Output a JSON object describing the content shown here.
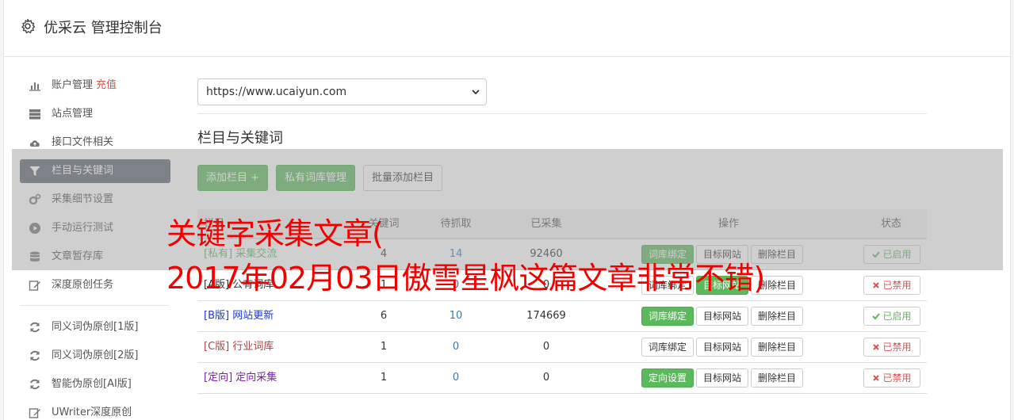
{
  "header": {
    "title": "优采云 管理控制台"
  },
  "sidebar": {
    "items": [
      {
        "label": "账户管理",
        "extra": "充值"
      },
      {
        "label": "站点管理"
      },
      {
        "label": "接口文件相关"
      },
      {
        "label": "栏目与关键词"
      },
      {
        "label": "采集细节设置"
      },
      {
        "label": "手动运行测试"
      },
      {
        "label": "文章暂存库"
      },
      {
        "label": "深度原创任务"
      }
    ],
    "items2": [
      {
        "label": "同义词伪原创[1版]"
      },
      {
        "label": "同义词伪原创[2版]"
      },
      {
        "label": "智能伪原创[AI版]"
      },
      {
        "label": "UWriter深度原创"
      }
    ]
  },
  "main": {
    "site_select": "https://www.ucaiyun.com",
    "section_title": "栏目与关键词",
    "btn_add": "添加栏目 +",
    "btn_private": "私有词库管理",
    "btn_batch": "批量添加栏目",
    "table": {
      "headers": {
        "name": "栏目",
        "n1": "关键词",
        "n2": "待抓取",
        "n3": "已采集",
        "ops": "操作",
        "status": "状态"
      },
      "rows": [
        {
          "tag": "[私有]",
          "name": "采集交流",
          "n1": "4",
          "n2": "14",
          "n3": "92460",
          "op1": "词库绑定",
          "op2": "目标网站",
          "op3": "删除栏目",
          "status": "已启用"
        },
        {
          "tag": "[A版]",
          "name": "公有词库",
          "n1": "1",
          "n2": "0",
          "n3": "0",
          "op1": "词库绑定",
          "op2": "目标网站",
          "op3": "删除栏目",
          "status": "已禁用"
        },
        {
          "tag": "[B版]",
          "name": "网站更新",
          "n1": "6",
          "n2": "10",
          "n3": "174669",
          "op1": "词库绑定",
          "op2": "目标网站",
          "op3": "删除栏目",
          "status": "已启用"
        },
        {
          "tag": "[C版]",
          "name": "行业词库",
          "n1": "1",
          "n2": "0",
          "n3": "0",
          "op1": "词库绑定",
          "op2": "目标网站",
          "op3": "删除栏目",
          "status": "已禁用"
        },
        {
          "tag": "[定向]",
          "name": "定向采集",
          "n1": "1",
          "n2": "0",
          "n3": "0",
          "op1": "定向设置",
          "op2": "目标网站",
          "op3": "删除栏目",
          "status": "已禁用"
        }
      ]
    }
  },
  "watermark": {
    "line1": "关键字采集文章(",
    "line2": "2017年02月03日傲雪星枫这篇文章非常不错)"
  },
  "colors": {
    "green": "#5cb85c",
    "red": "#d9534f",
    "nav_active": "#5b6270",
    "watermark": "#f20000"
  }
}
